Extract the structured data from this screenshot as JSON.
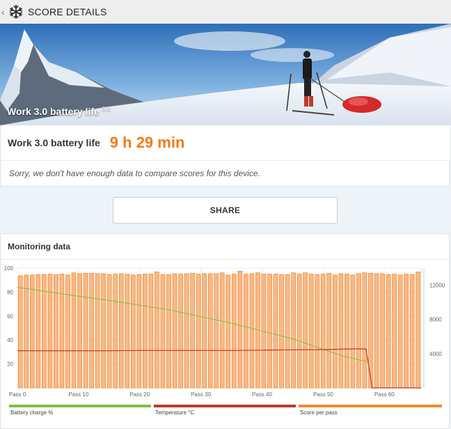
{
  "header": {
    "back_label": "‹",
    "title": "SCORE DETAILS",
    "logo_icon": "snowflake-icon"
  },
  "hero": {
    "title": "Work 3.0 battery life",
    "version": "3.0"
  },
  "score": {
    "label": "Work 3.0 battery life",
    "value": "9 h 29 min"
  },
  "compare_note": "Sorry, we don't have enough data to compare scores for this device.",
  "share_label": "SHARE",
  "monitoring": {
    "title": "Monitoring data",
    "legend": [
      {
        "label": "Battery charge %",
        "color": "#7dc242"
      },
      {
        "label": "Temperature °C",
        "color": "#c0392b"
      },
      {
        "label": "Score per pass",
        "color": "#f08a2a"
      }
    ]
  },
  "colors": {
    "accent": "#f07a1a",
    "bar_fill": "#f7b98a",
    "bar_stroke": "#f08a2a",
    "battery": "#8bc34a",
    "temperature": "#c0392b"
  },
  "chart_data": {
    "type": "bar",
    "title": "",
    "left_axis": {
      "ticks": [
        100,
        80,
        60,
        40,
        20
      ],
      "ylim": [
        0,
        100
      ]
    },
    "right_axis": {
      "ticks": [
        12000,
        8000,
        4000
      ],
      "ylim": [
        0,
        14000
      ]
    },
    "x_ticks": [
      "Pass 0",
      "Pass 10",
      "Pass 20",
      "Pass 30",
      "Pass 40",
      "Pass 50",
      "Pass 60"
    ],
    "grid": true,
    "legend_position": "bottom",
    "series": [
      {
        "name": "Score per pass",
        "axis": "right",
        "values": [
          13100,
          13200,
          13200,
          13250,
          13250,
          13300,
          13250,
          13300,
          13200,
          13450,
          13350,
          13400,
          13400,
          13350,
          13350,
          13250,
          13300,
          13350,
          13300,
          13200,
          13250,
          13300,
          13300,
          13550,
          13250,
          13250,
          13350,
          13300,
          13350,
          13400,
          13300,
          13350,
          13350,
          13350,
          13450,
          13200,
          13300,
          13650,
          13300,
          13350,
          13450,
          13300,
          13300,
          13300,
          13250,
          13250,
          13450,
          13300,
          13450,
          13300,
          13250,
          13300,
          13400,
          13200,
          13350,
          13300,
          13200,
          13350,
          13450,
          13400,
          13350,
          13350,
          13250,
          13300,
          13200,
          13300,
          13250,
          13550
        ]
      },
      {
        "name": "Battery charge %",
        "axis": "left",
        "points": [
          [
            0,
            84
          ],
          [
            8,
            78
          ],
          [
            15,
            73
          ],
          [
            25,
            65
          ],
          [
            35,
            54
          ],
          [
            45,
            41
          ],
          [
            53,
            27
          ],
          [
            57,
            22
          ]
        ]
      },
      {
        "name": "Temperature °C",
        "axis": "left",
        "points": [
          [
            0,
            31
          ],
          [
            5,
            31
          ],
          [
            10,
            31
          ],
          [
            15,
            31
          ],
          [
            20,
            31.3
          ],
          [
            25,
            31.2
          ],
          [
            30,
            31.3
          ],
          [
            35,
            31.2
          ],
          [
            40,
            31.5
          ],
          [
            45,
            31.8
          ],
          [
            50,
            32
          ],
          [
            54,
            32.5
          ],
          [
            56,
            32.6
          ],
          [
            57,
            32.5
          ],
          [
            58,
            0
          ],
          [
            66,
            0
          ]
        ]
      }
    ]
  }
}
